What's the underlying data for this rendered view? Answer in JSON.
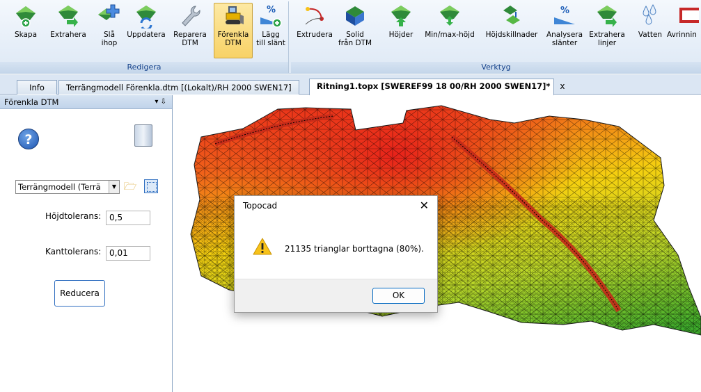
{
  "ribbon": {
    "groups": [
      {
        "label": "Redigera"
      },
      {
        "label": "Verktyg"
      }
    ],
    "buttons": [
      {
        "label": "Skapa",
        "icon": "terrain-plus-icon"
      },
      {
        "label": "Extrahera",
        "icon": "terrain-arrow-icon"
      },
      {
        "label": "Slå\nihop",
        "icon": "terrain-merge-icon"
      },
      {
        "label": "Uppdatera",
        "icon": "terrain-refresh-icon"
      },
      {
        "label": "Reparera\nDTM",
        "icon": "wrench-icon"
      },
      {
        "label": "Förenkla\nDTM",
        "icon": "bulldozer-icon"
      },
      {
        "label": "Lägg\ntill slänt",
        "icon": "slope-percent-plus-icon"
      },
      {
        "label": "Extrudera",
        "icon": "extrude-icon"
      },
      {
        "label": "Solid\nfrån DTM",
        "icon": "solid-icon"
      },
      {
        "label": "Höjder",
        "icon": "terrain-up-icon"
      },
      {
        "label": "Min/max-höjd",
        "icon": "terrain-minmax-icon"
      },
      {
        "label": "Höjdskillnader",
        "icon": "terrain-diff-icon"
      },
      {
        "label": "Analysera\nslänter",
        "icon": "slope-percent-icon"
      },
      {
        "label": "Extrahera\nlinjer",
        "icon": "terrain-lines-icon"
      },
      {
        "label": "Vatten",
        "icon": "water-drops-icon"
      },
      {
        "label": "Avrinnin",
        "icon": "runoff-icon"
      }
    ]
  },
  "tabs": [
    {
      "label": "Info"
    },
    {
      "label": "Terrängmodell Förenkla.dtm [(Lokalt)/RH 2000 SWEN17]"
    },
    {
      "label": "Ritning1.topx [SWEREF99 18 00/RH 2000 SWEN17]*",
      "close": "x"
    }
  ],
  "panel": {
    "title": "Förenkla DTM",
    "controls": "▾ ⇩",
    "model_select": "Terrängmodell (Terrä",
    "height_tolerance_label": "Höjdtolerans:",
    "height_tolerance_value": "0,5",
    "edge_tolerance_label": "Kanttolerans:",
    "edge_tolerance_value": "0,01",
    "reduce_button": "Reducera",
    "help_glyph": "?"
  },
  "dialog": {
    "title": "Topocad",
    "close": "✕",
    "message": "21135 trianglar borttagna (80%).",
    "ok": "OK"
  },
  "colors": {
    "accent": "#2f6ec0",
    "terrain_high": "#e8221a",
    "terrain_mid": "#f5d010",
    "terrain_low": "#3fae2c"
  }
}
